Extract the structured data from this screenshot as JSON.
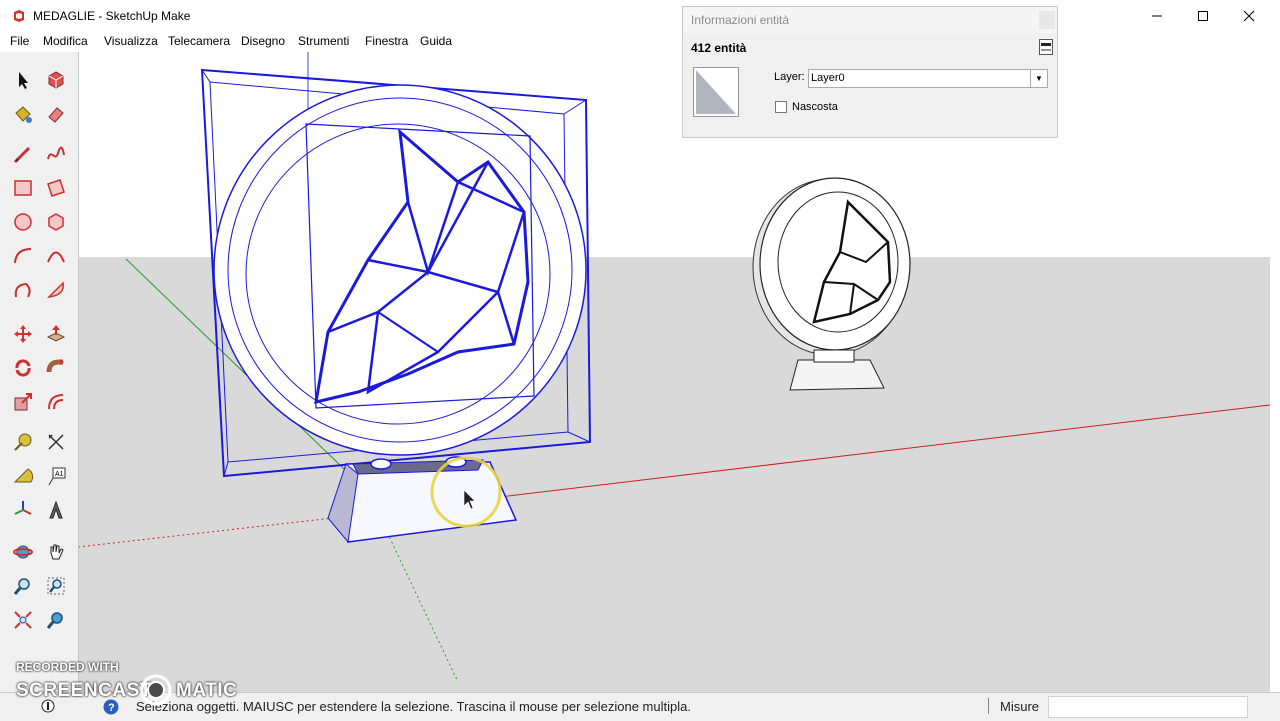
{
  "window": {
    "title": "MEDAGLIE - SketchUp Make"
  },
  "menu": {
    "items": [
      "File",
      "Modifica",
      "Visualizza",
      "Telecamera",
      "Disegno",
      "Strumenti",
      "Finestra",
      "Guida"
    ]
  },
  "toolbar": {
    "tools": [
      "select-icon",
      "make-component-icon",
      "paint-bucket-icon",
      "eraser-icon",
      "line-icon",
      "freehand-icon",
      "rectangle-icon",
      "rotated-rectangle-icon",
      "circle-icon",
      "polygon-icon",
      "arc-icon",
      "two-point-arc-icon",
      "three-point-arc-icon",
      "pie-icon",
      "move-icon",
      "push-pull-icon",
      "rotate-icon",
      "follow-me-icon",
      "scale-icon",
      "offset-icon",
      "tape-measure-icon",
      "dimension-icon",
      "protractor-icon",
      "text-icon",
      "axes-icon",
      "3d-text-icon",
      "orbit-icon",
      "pan-icon",
      "zoom-icon",
      "zoom-window-icon",
      "zoom-extents-icon",
      "previous-view-icon"
    ]
  },
  "entity_info": {
    "title": "Informazioni entità",
    "count_label": "412 entità",
    "layer_label": "Layer:",
    "layer_value": "Layer0",
    "hidden_label": "Nascosta"
  },
  "status": {
    "message": "Seleziona oggetti. MAIUSC per estendere la selezione. Trascina il mouse per selezione multipla.",
    "measure_label": "Misure",
    "measure_value": ""
  },
  "watermark": {
    "line1": "RECORDED WITH",
    "line2": "SCREENCAST",
    "line3": "MATIC"
  },
  "colors": {
    "selection": "#1a1adc",
    "sky": "#ffffff",
    "ground": "#d9d9d9",
    "axis_red": "#cc2020",
    "axis_green": "#2a9a2a",
    "cursor_highlight": "#e8d43a"
  }
}
